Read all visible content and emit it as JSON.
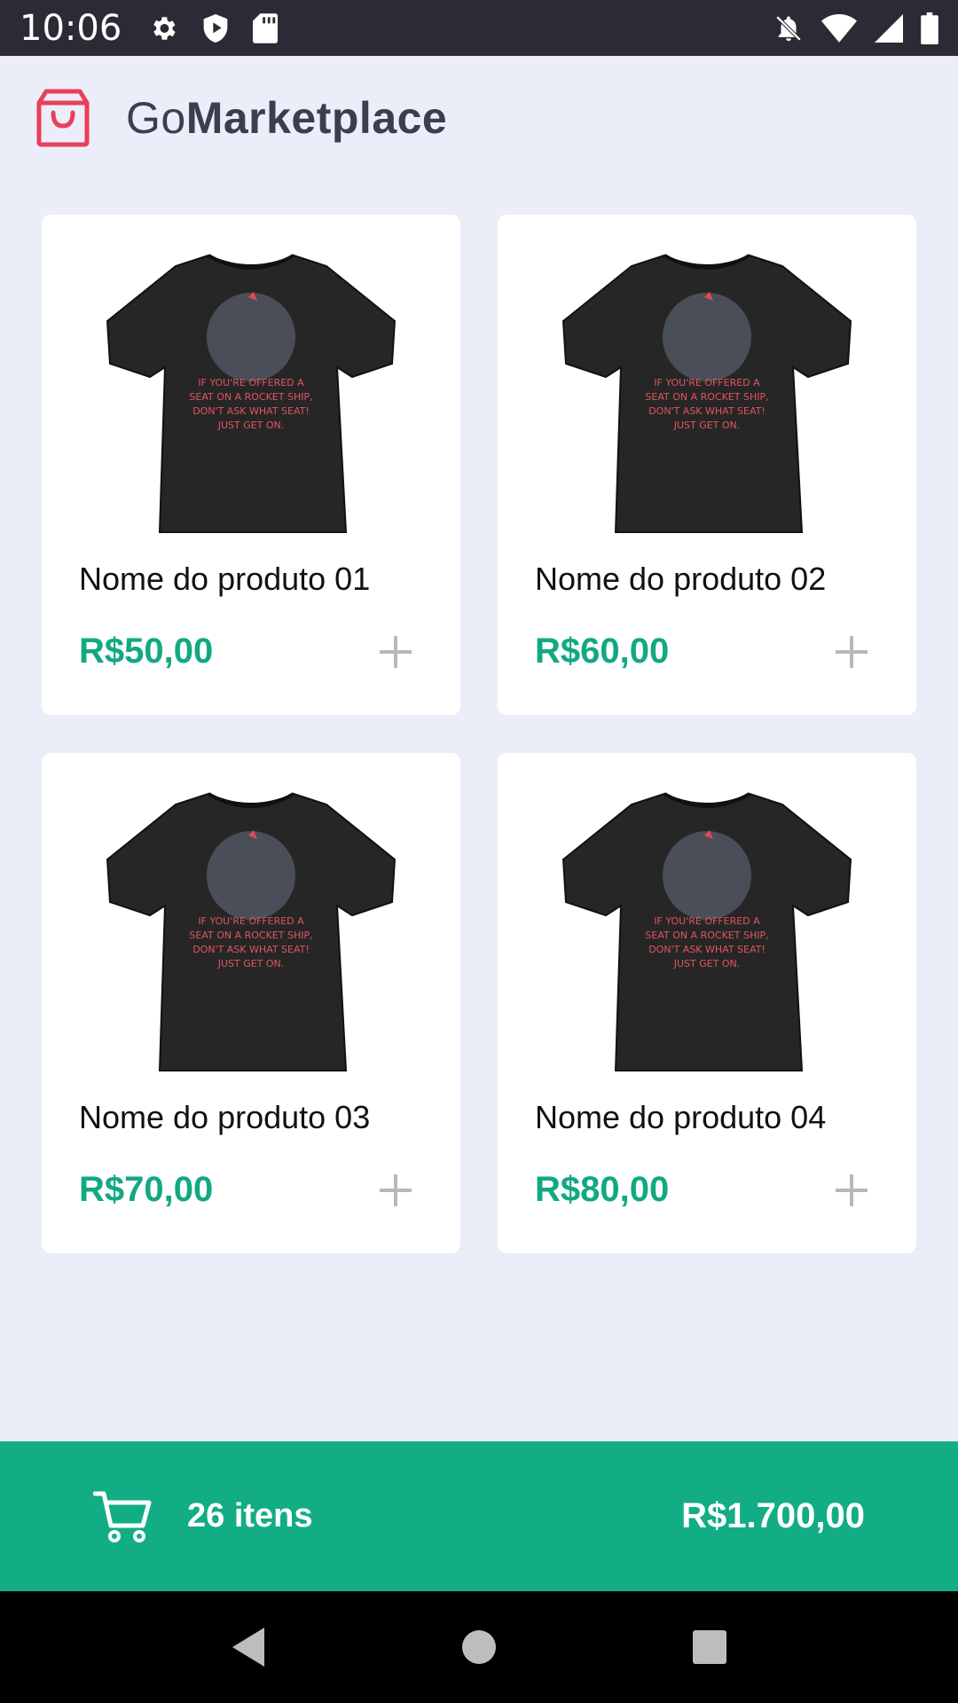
{
  "status_bar": {
    "time": "10:06",
    "left_icons": [
      "gear-icon",
      "shield-icon",
      "sd-card-icon"
    ],
    "right_icons": [
      "bell-off-icon",
      "wifi-icon",
      "signal-icon",
      "battery-icon"
    ]
  },
  "header": {
    "brand_icon": "shopping-bag-icon",
    "brand_light": "Go",
    "brand_bold": "Marketplace",
    "accent_color": "#E83F5B"
  },
  "products": [
    {
      "title": "Nome do produto 01",
      "price": "R$50,00",
      "image_text": "IF YOU'RE OFFERED A SEAT ON A ROCKET SHIP, DON'T ASK WHAT SEAT! JUST GET ON."
    },
    {
      "title": "Nome do produto 02",
      "price": "R$60,00",
      "image_text": "IF YOU'RE OFFERED A SEAT ON A ROCKET SHIP, DON'T ASK WHAT SEAT! JUST GET ON."
    },
    {
      "title": "Nome do produto 03",
      "price": "R$70,00",
      "image_text": "IF YOU'RE OFFERED A SEAT ON A ROCKET SHIP, DON'T ASK WHAT SEAT! JUST GET ON."
    },
    {
      "title": "Nome do produto 04",
      "price": "R$80,00",
      "image_text": "IF YOU'RE OFFERED A SEAT ON A ROCKET SHIP, DON'T ASK WHAT SEAT! JUST GET ON."
    }
  ],
  "cart": {
    "icon": "cart-icon",
    "count_label": "26 itens",
    "total": "R$1.700,00",
    "color": "#12AD84"
  },
  "nav": {
    "buttons": [
      "back-icon",
      "home-icon",
      "recents-icon"
    ]
  },
  "colors": {
    "background": "#EBEEF8",
    "price": "#12A982",
    "text_dark": "#3D3D4D"
  }
}
